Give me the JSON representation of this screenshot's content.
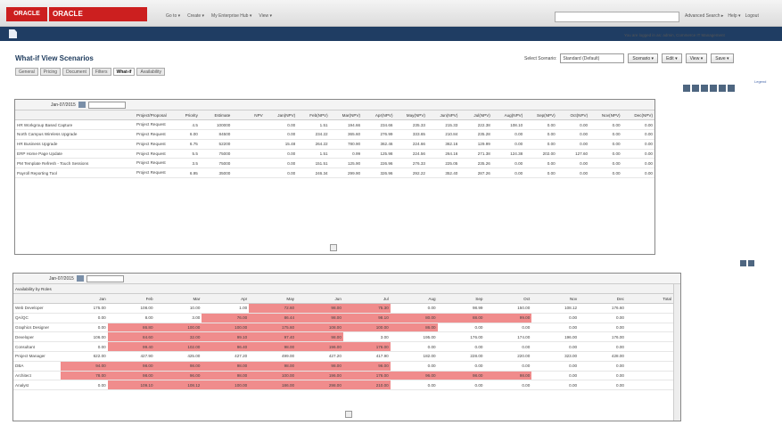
{
  "header": {
    "logo_small": "ORACLE",
    "logo_main": "ORACLE",
    "menus": [
      "Go to ▾",
      "Create ▾",
      "My Enterprise Hub ▾",
      "View ▾"
    ],
    "links": [
      "Advanced Search ▸",
      "Help ▾",
      "Logout"
    ],
    "user_line": "You are logged in as: admin, Commerce IT Management"
  },
  "page": {
    "title": "What-if View Scenarios",
    "scenario_label": "Select Scenario:",
    "scenario_value": "Standard (Default)",
    "buttons": [
      "Scenario ▾",
      "Edit ▾",
      "View ▾",
      "Save ▾"
    ],
    "tabs": [
      "General",
      "Pricing",
      "Document",
      "Filters",
      "What-if",
      "Availability"
    ],
    "active_tab": 4,
    "legend": "Legend"
  },
  "top_panel": {
    "date": "Jan-07/2015",
    "columns": [
      "",
      "Project/Proposal",
      "Priority",
      "Estimate",
      "NPV",
      "Jan(NPV)",
      "Feb(NPV)",
      "Mar(NPV)",
      "Apr(NPV)",
      "May(NPV)",
      "Jun(NPV)",
      "Jul(NPV)",
      "Aug(NPV)",
      "Sep(NPV)",
      "Oct(NPV)",
      "Nov(NPV)",
      "Dec(NPV)"
    ],
    "rows": [
      {
        "name": "HR Workgroup Based Capture",
        "type": "Project Request",
        "priority": "4.5",
        "estimate": "100000",
        "v": [
          "0.00",
          "1.51",
          "194.66",
          "234.66",
          "235.33",
          "215.33",
          "222.38",
          "108.10",
          "0.00",
          "0.00",
          "0.00",
          "0.00"
        ]
      },
      {
        "name": "North Campus Wireless Upgrade",
        "type": "Project Request",
        "priority": "6.00",
        "estimate": "84500",
        "v": [
          "0.00",
          "234.22",
          "365.60",
          "276.99",
          "333.65",
          "210.84",
          "235.28",
          "0.00",
          "0.00",
          "0.00",
          "0.00",
          "0.00"
        ]
      },
      {
        "name": "HR Business Upgrade",
        "type": "Project Request",
        "priority": "6.75",
        "estimate": "52200",
        "v": [
          "15.48",
          "264.22",
          "780.90",
          "362.46",
          "224.66",
          "362.16",
          "129.99",
          "0.00",
          "0.00",
          "0.00",
          "0.00",
          "0.00"
        ]
      },
      {
        "name": "ERP Home Page Update",
        "type": "Project Request",
        "priority": "5.5",
        "estimate": "75000",
        "v": [
          "0.00",
          "1.51",
          "0.99",
          "125.98",
          "224.56",
          "264.16",
          "271.38",
          "124.38",
          "202.00",
          "127.60",
          "0.00",
          "0.00"
        ]
      },
      {
        "name": "PM Template Refresh - Touch Sessions",
        "type": "Project Request",
        "priority": "3.5",
        "estimate": "75000",
        "v": [
          "0.00",
          "151.51",
          "125.90",
          "226.96",
          "276.33",
          "225.05",
          "235.26",
          "0.00",
          "0.00",
          "0.00",
          "0.00",
          "0.00"
        ]
      },
      {
        "name": "Payroll Reporting Tool",
        "type": "Project Request",
        "priority": "6.95",
        "estimate": "35000",
        "v": [
          "0.00",
          "246.34",
          "299.90",
          "326.96",
          "292.22",
          "352.40",
          "287.26",
          "0.00",
          "0.00",
          "0.00",
          "0.00",
          "0.00"
        ]
      }
    ]
  },
  "bottom_panel": {
    "date": "Jan-07/2015",
    "title": "Availability by Roles",
    "columns": [
      "",
      "Jan",
      "Feb",
      "Mar",
      "Apr",
      "May",
      "Jun",
      "Jul",
      "Aug",
      "Sep",
      "Oct",
      "Nov",
      "Dec",
      "Total"
    ],
    "rows": [
      {
        "name": "Web Developer",
        "v": [
          "175.00",
          "108.00",
          "10.00",
          "1.00",
          "72.60",
          "98.00",
          "75.30",
          "0.00",
          "98.99",
          "150.00",
          "108.12",
          "176.60"
        ],
        "red": [
          4,
          5,
          6
        ]
      },
      {
        "name": "QA/QC",
        "v": [
          "0.00",
          "8.00",
          "3.00",
          "76.00",
          "86.44",
          "98.00",
          "98.10",
          "80.00",
          "88.00",
          "99.00",
          "0.00",
          "0.00"
        ],
        "red": [
          3,
          4,
          5,
          6,
          7,
          8,
          9
        ]
      },
      {
        "name": "Graphics Designer",
        "v": [
          "0.00",
          "86.80",
          "100.00",
          "100.00",
          "175.60",
          "108.00",
          "100.00",
          "86.00",
          "0.00",
          "0.00",
          "0.00",
          "0.00"
        ],
        "red": [
          1,
          2,
          3,
          4,
          5,
          6,
          7
        ]
      },
      {
        "name": "Developer",
        "v": [
          "106.00",
          "84.60",
          "32.00",
          "99.10",
          "97.40",
          "98.00",
          "3.00",
          "195.00",
          "176.00",
          "174.00",
          "196.00",
          "176.00"
        ],
        "red": [
          1,
          2,
          3,
          4,
          5
        ]
      },
      {
        "name": "Consultant",
        "v": [
          "0.00",
          "99.40",
          "102.00",
          "96.40",
          "98.00",
          "196.00",
          "176.00",
          "0.00",
          "0.00",
          "0.00",
          "0.00",
          "0.00"
        ],
        "red": [
          1,
          2,
          3,
          4,
          5,
          6
        ]
      },
      {
        "name": "Project Manager",
        "v": [
          "622.00",
          "427.90",
          "425.00",
          "427.20",
          "499.00",
          "427.20",
          "417.90",
          "182.00",
          "228.00",
          "220.00",
          "323.00",
          "428.00"
        ],
        "red": []
      },
      {
        "name": "DBA",
        "v": [
          "94.00",
          "98.00",
          "98.00",
          "98.00",
          "98.00",
          "98.00",
          "96.00",
          "0.00",
          "0.00",
          "0.00",
          "0.00",
          "0.00"
        ],
        "red": [
          0,
          1,
          2,
          3,
          4,
          5,
          6
        ]
      },
      {
        "name": "Architect",
        "v": [
          "78.00",
          "98.00",
          "96.00",
          "98.00",
          "100.00",
          "196.00",
          "176.00",
          "96.00",
          "98.00",
          "98.00",
          "0.00",
          "0.00"
        ],
        "red": [
          0,
          1,
          2,
          3,
          4,
          5,
          6,
          7,
          8,
          9
        ]
      },
      {
        "name": "Analyst",
        "v": [
          "0.00",
          "109.10",
          "108.12",
          "100.00",
          "186.00",
          "298.00",
          "210.00",
          "0.00",
          "0.00",
          "0.00",
          "0.00",
          "0.00"
        ],
        "red": [
          1,
          2,
          3,
          4,
          5,
          6
        ]
      }
    ]
  }
}
